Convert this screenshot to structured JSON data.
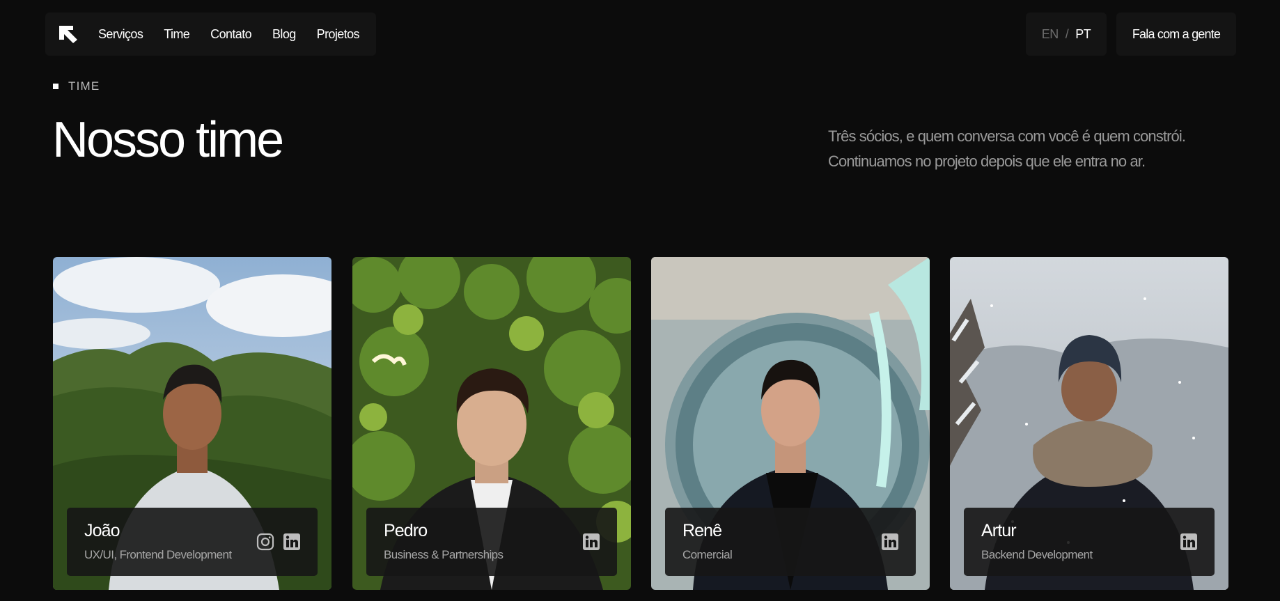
{
  "nav": {
    "links": [
      "Serviços",
      "Time",
      "Contato",
      "Blog",
      "Projetos"
    ],
    "lang_en": "EN",
    "lang_sep": "/",
    "lang_pt": "PT",
    "cta": "Fala com a gente"
  },
  "section": {
    "eyebrow": "TIME",
    "title": "Nosso time",
    "intro_line1": "Três sócios, e quem conversa com você é quem constrói.",
    "intro_line2": "Continuamos no projeto depois que ele entra no ar."
  },
  "team": [
    {
      "name": "João",
      "role": "UX/UI, Frontend Development",
      "socials": [
        "instagram-icon",
        "linkedin-icon"
      ]
    },
    {
      "name": "Pedro",
      "role": "Business & Partnerships",
      "socials": [
        "linkedin-icon"
      ]
    },
    {
      "name": "Renê",
      "role": "Comercial",
      "socials": [
        "linkedin-icon"
      ]
    },
    {
      "name": "Artur",
      "role": "Backend Development",
      "socials": [
        "linkedin-icon"
      ]
    }
  ],
  "colors": {
    "background": "#0c0c0c",
    "surface": "#141414",
    "muted": "#9a9a9a"
  }
}
